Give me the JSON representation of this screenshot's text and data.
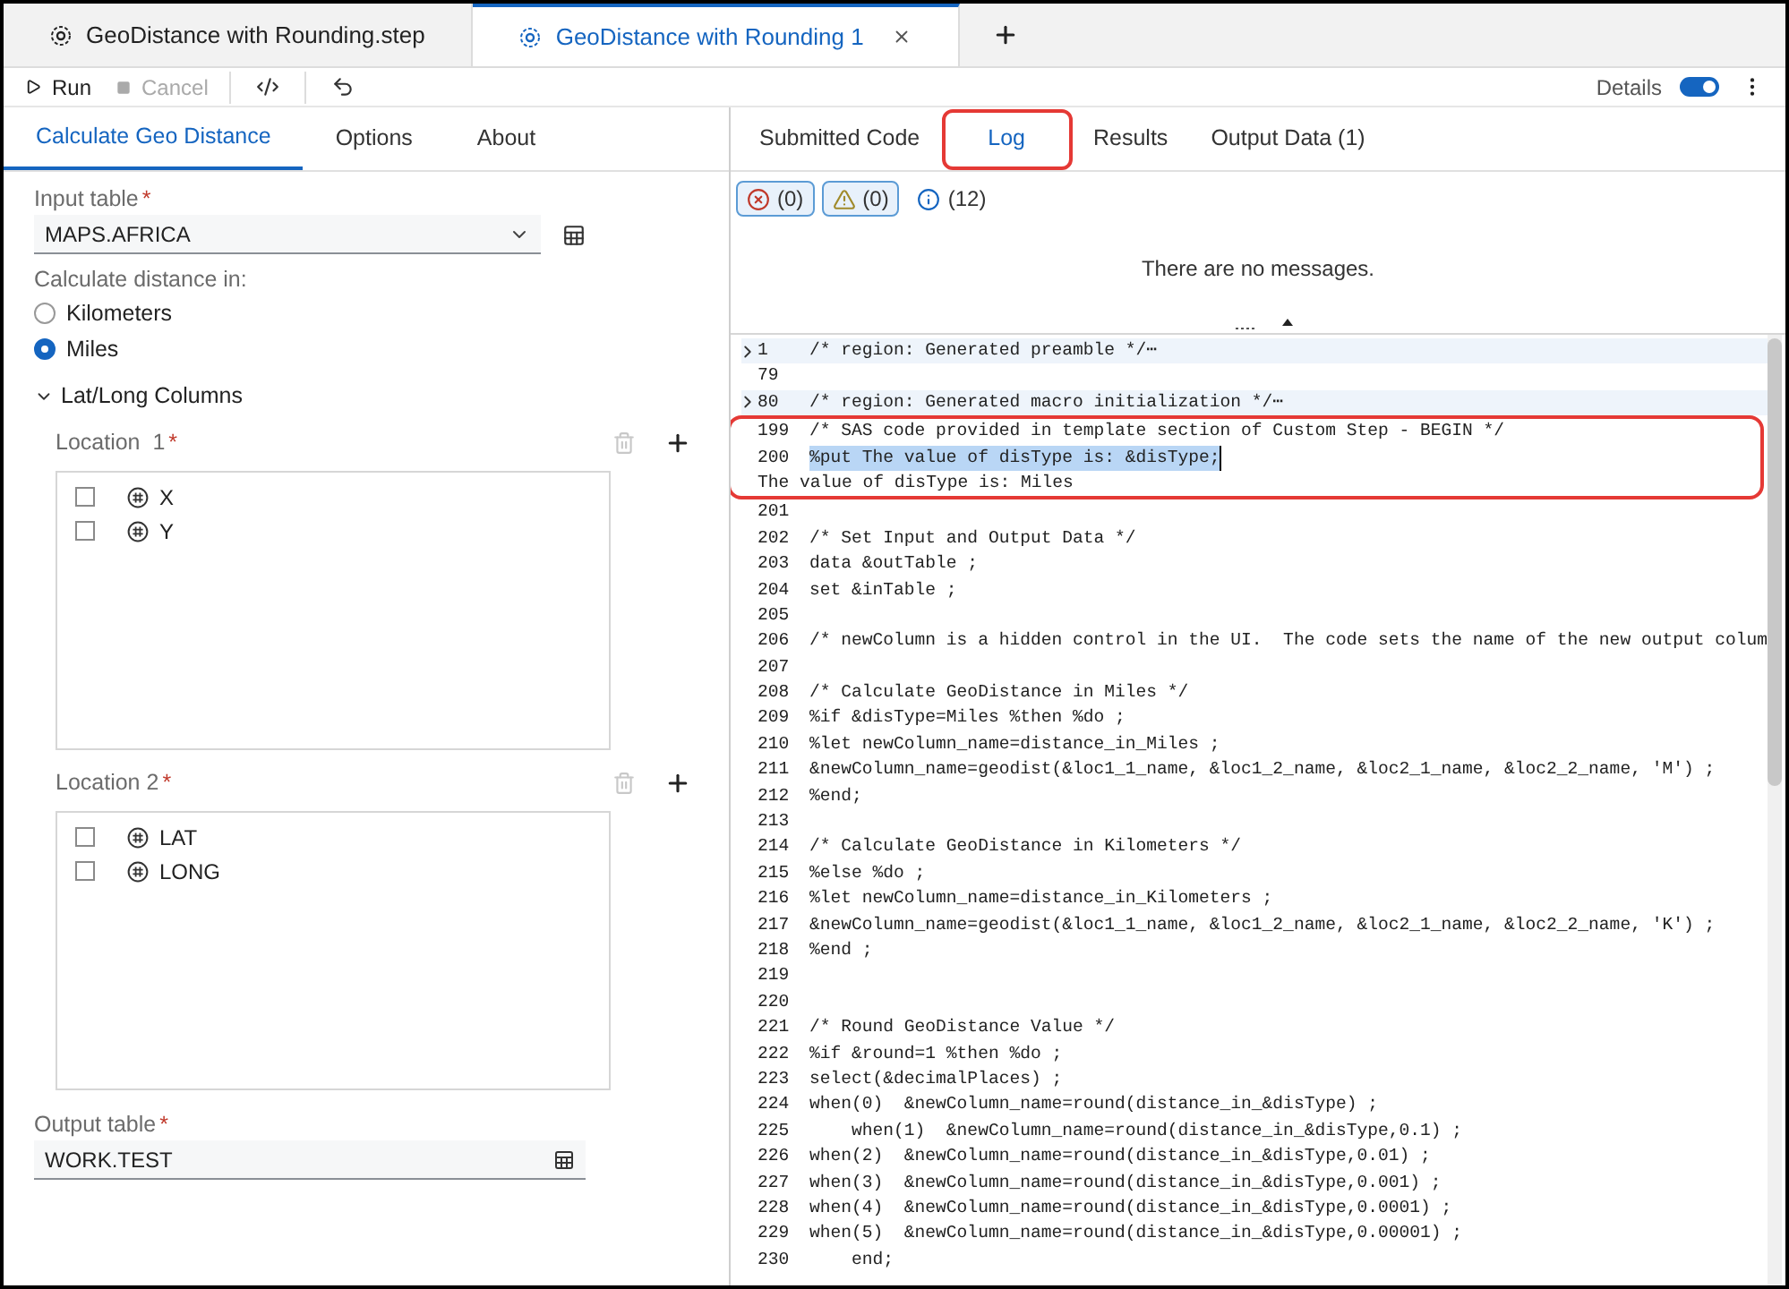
{
  "editor_tabs": [
    {
      "label": "GeoDistance with Rounding.step",
      "selected": false,
      "closable": false
    },
    {
      "label": "GeoDistance with Rounding 1",
      "selected": true,
      "closable": true
    }
  ],
  "toolbar": {
    "run": {
      "label": "Run",
      "disabled": false
    },
    "cancel": {
      "label": "Cancel",
      "disabled": true
    },
    "details": {
      "label": "Details",
      "on": true
    }
  },
  "step_tabs": [
    {
      "label": "Calculate Geo Distance",
      "selected": true
    },
    {
      "label": "Options",
      "selected": false
    },
    {
      "label": "About",
      "selected": false
    }
  ],
  "form": {
    "input_table": {
      "label": "Input table",
      "required_mark": "*",
      "value": "MAPS.AFRICA"
    },
    "distance": {
      "label": "Calculate distance in:",
      "options": [
        {
          "label": "Kilometers",
          "selected": false
        },
        {
          "label": "Miles",
          "selected": true
        }
      ]
    },
    "section": {
      "label": "Lat/Long Columns",
      "expanded": true
    },
    "locations": [
      {
        "label": "Location  1",
        "required_mark": "*",
        "columns": [
          {
            "name": "X",
            "checked": false
          },
          {
            "name": "Y",
            "checked": false
          }
        ]
      },
      {
        "label": "Location 2",
        "required_mark": "*",
        "columns": [
          {
            "name": "LAT",
            "checked": false
          },
          {
            "name": "LONG",
            "checked": false
          }
        ]
      }
    ],
    "output_table": {
      "label": "Output table",
      "required_mark": "*",
      "value": "WORK.TEST"
    }
  },
  "results_tabs": [
    {
      "label": "Submitted Code",
      "selected": false,
      "outlined": false
    },
    {
      "label": "Log",
      "selected": true,
      "outlined": true
    },
    {
      "label": "Results",
      "selected": false,
      "outlined": false
    },
    {
      "label": "Output Data (1)",
      "selected": false,
      "outlined": false
    }
  ],
  "filters": [
    {
      "kind": "error",
      "count": "(0)",
      "pressed": true
    },
    {
      "kind": "warning",
      "count": "(0)",
      "pressed": true
    },
    {
      "kind": "info",
      "count": "(12)",
      "pressed": false
    }
  ],
  "messages_empty": "There are no messages.",
  "code_blocks": [
    {
      "framed": false,
      "lines": [
        {
          "kind": "region",
          "number": "1",
          "text": "/* region: Generated preamble */⋯"
        },
        {
          "kind": "code",
          "number": "79"
        },
        {
          "kind": "region",
          "number": "80",
          "text": "/* region: Generated macro initialization */⋯"
        }
      ]
    },
    {
      "framed": true,
      "lines": [
        {
          "kind": "code",
          "number": "199",
          "text": "/* SAS code provided in template section of Custom Step - BEGIN */"
        },
        {
          "kind": "selection",
          "number": "200",
          "text": "%put The value of disType is: &disType;"
        },
        {
          "kind": "output",
          "text": "The value of disType is: Miles"
        }
      ]
    },
    {
      "framed": false,
      "lines": [
        {
          "kind": "code",
          "number": "201"
        },
        {
          "kind": "code",
          "number": "202",
          "text": "/* Set Input and Output Data */"
        },
        {
          "kind": "code",
          "number": "203",
          "text": "data &outTable ;"
        },
        {
          "kind": "code",
          "number": "204",
          "text": "set &inTable ;"
        },
        {
          "kind": "code",
          "number": "205"
        },
        {
          "kind": "code",
          "number": "206",
          "text": "/* newColumn is a hidden control in the UI.  The code sets the name of the new output colum"
        },
        {
          "kind": "code",
          "number": "207"
        },
        {
          "kind": "code",
          "number": "208",
          "text": "/* Calculate GeoDistance in Miles */"
        },
        {
          "kind": "code",
          "number": "209",
          "text": "%if &disType=Miles %then %do ;"
        },
        {
          "kind": "code",
          "number": "210",
          "text": "%let newColumn_name=distance_in_Miles ;"
        },
        {
          "kind": "code",
          "number": "211",
          "text": "&newColumn_name=geodist(&loc1_1_name, &loc1_2_name, &loc2_1_name, &loc2_2_name, 'M') ;"
        },
        {
          "kind": "code",
          "number": "212",
          "text": "%end;"
        },
        {
          "kind": "code",
          "number": "213"
        },
        {
          "kind": "code",
          "number": "214",
          "text": "/* Calculate GeoDistance in Kilometers */"
        },
        {
          "kind": "code",
          "number": "215",
          "text": "%else %do ;"
        },
        {
          "kind": "code",
          "number": "216",
          "text": "%let newColumn_name=distance_in_Kilometers ;"
        },
        {
          "kind": "code",
          "number": "217",
          "text": "&newColumn_name=geodist(&loc1_1_name, &loc1_2_name, &loc2_1_name, &loc2_2_name, 'K') ;"
        },
        {
          "kind": "code",
          "number": "218",
          "text": "%end ;"
        },
        {
          "kind": "code",
          "number": "219"
        },
        {
          "kind": "code",
          "number": "220"
        },
        {
          "kind": "code",
          "number": "221",
          "text": "/* Round GeoDistance Value */"
        },
        {
          "kind": "code",
          "number": "222",
          "text": "%if &round=1 %then %do ;"
        },
        {
          "kind": "code",
          "number": "223",
          "text": "select(&decimalPlaces) ;"
        },
        {
          "kind": "code",
          "number": "224",
          "text": "when(0)  &newColumn_name=round(distance_in_&disType) ;"
        },
        {
          "kind": "code",
          "number": "225",
          "text": "    when(1)  &newColumn_name=round(distance_in_&disType,0.1) ;"
        },
        {
          "kind": "code",
          "number": "226",
          "text": "when(2)  &newColumn_name=round(distance_in_&disType,0.01) ;"
        },
        {
          "kind": "code",
          "number": "227",
          "text": "when(3)  &newColumn_name=round(distance_in_&disType,0.001) ;"
        },
        {
          "kind": "code",
          "number": "228",
          "text": "when(4)  &newColumn_name=round(distance_in_&disType,0.0001) ;"
        },
        {
          "kind": "code",
          "number": "229",
          "text": "when(5)  &newColumn_name=round(distance_in_&disType,0.00001) ;"
        },
        {
          "kind": "code",
          "number": "230",
          "text": "    end;"
        }
      ]
    }
  ]
}
